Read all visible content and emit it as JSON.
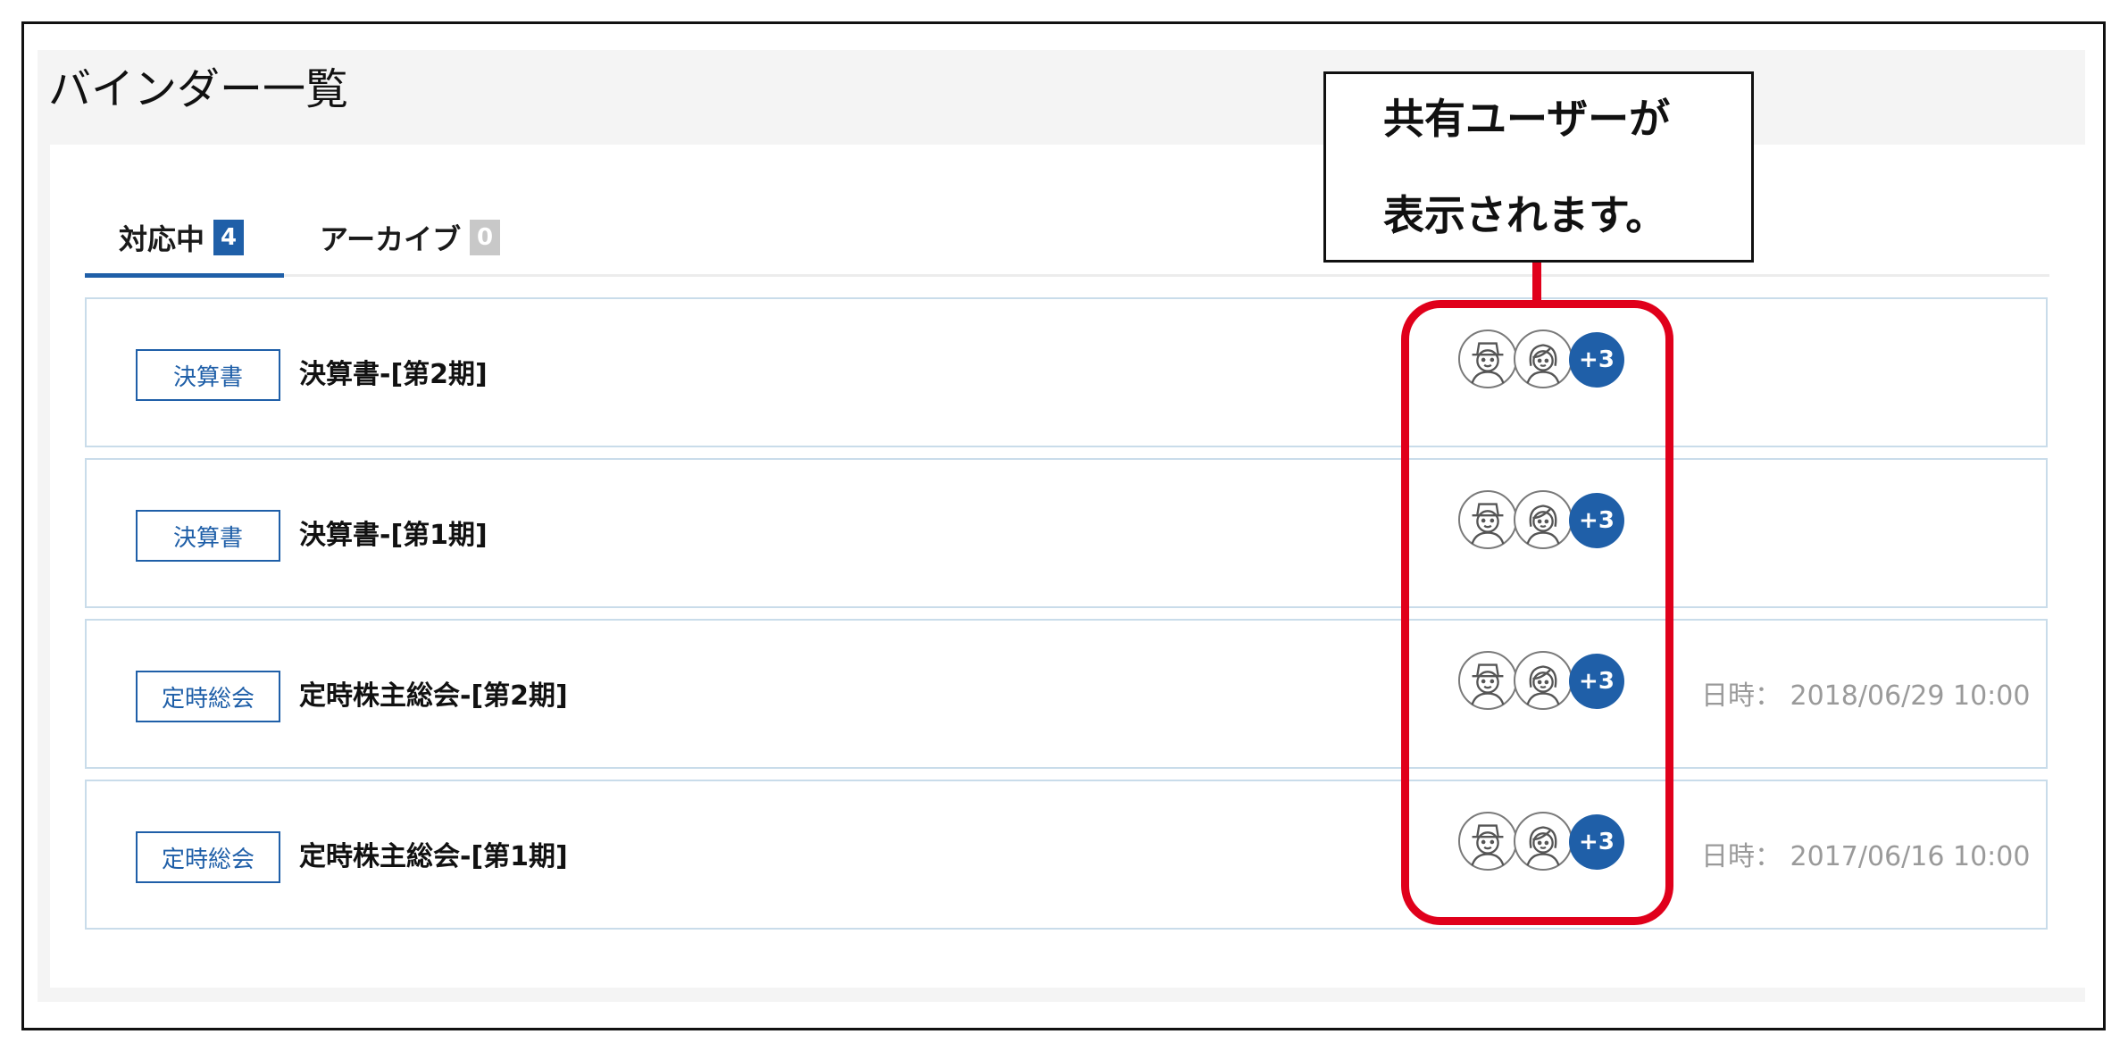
{
  "page": {
    "title": "バインダー一覧"
  },
  "tabs": [
    {
      "label": "対応中",
      "count": "4"
    },
    {
      "label": "アーカイブ",
      "count": "0"
    }
  ],
  "binders": [
    {
      "category": "決算書",
      "title": "決算書-[第2期]",
      "shared_more": "+3",
      "date": ""
    },
    {
      "category": "決算書",
      "title": "決算書-[第1期]",
      "shared_more": "+3",
      "date": ""
    },
    {
      "category": "定時総会",
      "title": "定時株主総会-[第2期]",
      "shared_more": "+3",
      "date": "日時： 2018/06/29 10:00"
    },
    {
      "category": "定時総会",
      "title": "定時株主総会-[第1期]",
      "shared_more": "+3",
      "date": "日時： 2017/06/16 10:00"
    }
  ],
  "callout": {
    "line1": "共有ユーザーが",
    "line2": "表示されます。"
  },
  "colors": {
    "accent": "#1f5fa8",
    "highlight": "#e0001b",
    "row_border": "#c9dcea",
    "muted_text": "#9a9a9a"
  },
  "icons": {
    "user_avatar_1": "man-with-hat-avatar-icon",
    "user_avatar_2": "woman-avatar-icon"
  }
}
